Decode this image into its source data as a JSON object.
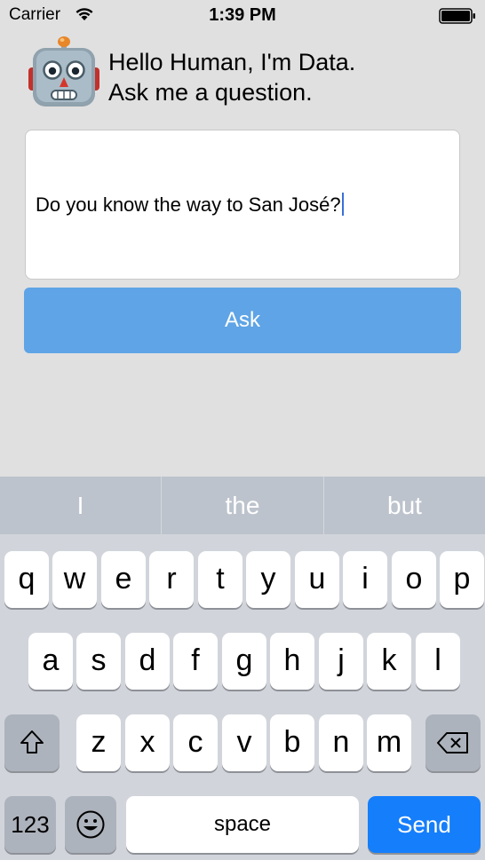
{
  "status_bar": {
    "carrier": "Carrier",
    "time": "1:39 PM",
    "wifi_icon": "wifi-icon",
    "battery_icon": "battery-icon"
  },
  "header": {
    "avatar_icon": "robot-icon",
    "greeting_line1": "Hello Human, I'm Data.",
    "greeting_line2": "Ask me a question."
  },
  "question": {
    "value": "Do you know the way to San José?"
  },
  "ask_button": {
    "label": "Ask",
    "color": "#5ea4e6"
  },
  "keyboard": {
    "suggestions": [
      "I",
      "the",
      "but"
    ],
    "row1": [
      "q",
      "w",
      "e",
      "r",
      "t",
      "y",
      "u",
      "i",
      "o",
      "p"
    ],
    "row2": [
      "a",
      "s",
      "d",
      "f",
      "g",
      "h",
      "j",
      "k",
      "l"
    ],
    "row3": [
      "z",
      "x",
      "c",
      "v",
      "b",
      "n",
      "m"
    ],
    "shift_icon": "shift-icon",
    "backspace_icon": "backspace-icon",
    "numbers_label": "123",
    "emoji_icon": "emoji-icon",
    "space_label": "space",
    "send_label": "Send",
    "send_color": "#157efb"
  }
}
